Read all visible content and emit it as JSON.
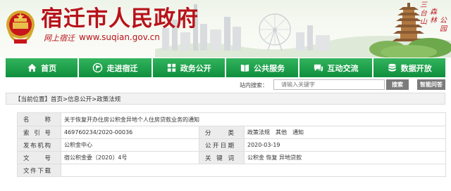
{
  "header": {
    "site_title": "宿迁市人民政府",
    "slogan": "网上宿迁",
    "url": "www.suqian.gov.cn",
    "calligraphy": [
      "三台山",
      "森林",
      "公园"
    ]
  },
  "nav": {
    "items": [
      {
        "label": "首页",
        "icon": "home-icon"
      },
      {
        "label": "走进宿迁",
        "icon": "flag-icon"
      },
      {
        "label": "政务公开",
        "icon": "grid-icon"
      },
      {
        "label": "公共服务",
        "icon": "book-icon"
      },
      {
        "label": "互动交流",
        "icon": "chat-icon"
      },
      {
        "label": "数据开放",
        "icon": "database-icon"
      }
    ]
  },
  "search": {
    "label": "站内搜索：",
    "placeholder": "请输入关键字",
    "button": "搜索",
    "advanced": "智能问答"
  },
  "location": {
    "prefix": "【当前位置】",
    "path": "首页>信息公开>政策法规"
  },
  "info": {
    "name_label": "名　　称",
    "name_value": "关于恢复开办住房公积金异地个人住房贷款业务的通知",
    "index_label": "索 引 号",
    "index_value": "469760234/2020-00036",
    "category_label": "分　　类",
    "category_value": "政策法规　其他　通知",
    "publisher_label": "发布机构",
    "publisher_value": "公积金中心",
    "date_label": "公开日期",
    "date_value": "2020-03-19",
    "doc_label": "文　　号",
    "doc_value": "宿公积金委〔2020〕4号",
    "keywords_label": "关 键 词",
    "keywords_value": "公积金 恢复 异地贷款",
    "download_label": "文件下载"
  },
  "colors": {
    "brand_red": "#b8121a",
    "nav_green": "#1fa24a",
    "button_gray": "#7b7b7b"
  }
}
